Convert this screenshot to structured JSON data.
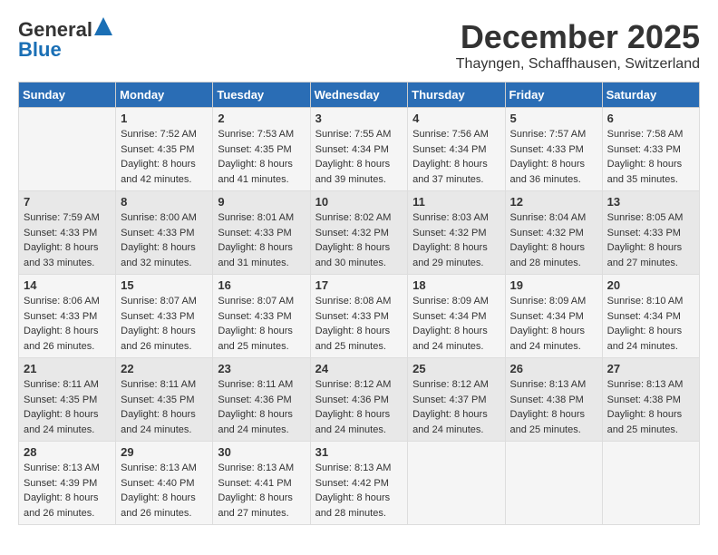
{
  "logo": {
    "general": "General",
    "blue": "Blue"
  },
  "title": {
    "month": "December 2025",
    "location": "Thayngen, Schaffhausen, Switzerland"
  },
  "weekdays": [
    "Sunday",
    "Monday",
    "Tuesday",
    "Wednesday",
    "Thursday",
    "Friday",
    "Saturday"
  ],
  "weeks": [
    [
      {
        "day": "",
        "info": ""
      },
      {
        "day": "1",
        "info": "Sunrise: 7:52 AM\nSunset: 4:35 PM\nDaylight: 8 hours\nand 42 minutes."
      },
      {
        "day": "2",
        "info": "Sunrise: 7:53 AM\nSunset: 4:35 PM\nDaylight: 8 hours\nand 41 minutes."
      },
      {
        "day": "3",
        "info": "Sunrise: 7:55 AM\nSunset: 4:34 PM\nDaylight: 8 hours\nand 39 minutes."
      },
      {
        "day": "4",
        "info": "Sunrise: 7:56 AM\nSunset: 4:34 PM\nDaylight: 8 hours\nand 37 minutes."
      },
      {
        "day": "5",
        "info": "Sunrise: 7:57 AM\nSunset: 4:33 PM\nDaylight: 8 hours\nand 36 minutes."
      },
      {
        "day": "6",
        "info": "Sunrise: 7:58 AM\nSunset: 4:33 PM\nDaylight: 8 hours\nand 35 minutes."
      }
    ],
    [
      {
        "day": "7",
        "info": "Sunrise: 7:59 AM\nSunset: 4:33 PM\nDaylight: 8 hours\nand 33 minutes."
      },
      {
        "day": "8",
        "info": "Sunrise: 8:00 AM\nSunset: 4:33 PM\nDaylight: 8 hours\nand 32 minutes."
      },
      {
        "day": "9",
        "info": "Sunrise: 8:01 AM\nSunset: 4:33 PM\nDaylight: 8 hours\nand 31 minutes."
      },
      {
        "day": "10",
        "info": "Sunrise: 8:02 AM\nSunset: 4:32 PM\nDaylight: 8 hours\nand 30 minutes."
      },
      {
        "day": "11",
        "info": "Sunrise: 8:03 AM\nSunset: 4:32 PM\nDaylight: 8 hours\nand 29 minutes."
      },
      {
        "day": "12",
        "info": "Sunrise: 8:04 AM\nSunset: 4:32 PM\nDaylight: 8 hours\nand 28 minutes."
      },
      {
        "day": "13",
        "info": "Sunrise: 8:05 AM\nSunset: 4:33 PM\nDaylight: 8 hours\nand 27 minutes."
      }
    ],
    [
      {
        "day": "14",
        "info": "Sunrise: 8:06 AM\nSunset: 4:33 PM\nDaylight: 8 hours\nand 26 minutes."
      },
      {
        "day": "15",
        "info": "Sunrise: 8:07 AM\nSunset: 4:33 PM\nDaylight: 8 hours\nand 26 minutes."
      },
      {
        "day": "16",
        "info": "Sunrise: 8:07 AM\nSunset: 4:33 PM\nDaylight: 8 hours\nand 25 minutes."
      },
      {
        "day": "17",
        "info": "Sunrise: 8:08 AM\nSunset: 4:33 PM\nDaylight: 8 hours\nand 25 minutes."
      },
      {
        "day": "18",
        "info": "Sunrise: 8:09 AM\nSunset: 4:34 PM\nDaylight: 8 hours\nand 24 minutes."
      },
      {
        "day": "19",
        "info": "Sunrise: 8:09 AM\nSunset: 4:34 PM\nDaylight: 8 hours\nand 24 minutes."
      },
      {
        "day": "20",
        "info": "Sunrise: 8:10 AM\nSunset: 4:34 PM\nDaylight: 8 hours\nand 24 minutes."
      }
    ],
    [
      {
        "day": "21",
        "info": "Sunrise: 8:11 AM\nSunset: 4:35 PM\nDaylight: 8 hours\nand 24 minutes."
      },
      {
        "day": "22",
        "info": "Sunrise: 8:11 AM\nSunset: 4:35 PM\nDaylight: 8 hours\nand 24 minutes."
      },
      {
        "day": "23",
        "info": "Sunrise: 8:11 AM\nSunset: 4:36 PM\nDaylight: 8 hours\nand 24 minutes."
      },
      {
        "day": "24",
        "info": "Sunrise: 8:12 AM\nSunset: 4:36 PM\nDaylight: 8 hours\nand 24 minutes."
      },
      {
        "day": "25",
        "info": "Sunrise: 8:12 AM\nSunset: 4:37 PM\nDaylight: 8 hours\nand 24 minutes."
      },
      {
        "day": "26",
        "info": "Sunrise: 8:13 AM\nSunset: 4:38 PM\nDaylight: 8 hours\nand 25 minutes."
      },
      {
        "day": "27",
        "info": "Sunrise: 8:13 AM\nSunset: 4:38 PM\nDaylight: 8 hours\nand 25 minutes."
      }
    ],
    [
      {
        "day": "28",
        "info": "Sunrise: 8:13 AM\nSunset: 4:39 PM\nDaylight: 8 hours\nand 26 minutes."
      },
      {
        "day": "29",
        "info": "Sunrise: 8:13 AM\nSunset: 4:40 PM\nDaylight: 8 hours\nand 26 minutes."
      },
      {
        "day": "30",
        "info": "Sunrise: 8:13 AM\nSunset: 4:41 PM\nDaylight: 8 hours\nand 27 minutes."
      },
      {
        "day": "31",
        "info": "Sunrise: 8:13 AM\nSunset: 4:42 PM\nDaylight: 8 hours\nand 28 minutes."
      },
      {
        "day": "",
        "info": ""
      },
      {
        "day": "",
        "info": ""
      },
      {
        "day": "",
        "info": ""
      }
    ]
  ]
}
